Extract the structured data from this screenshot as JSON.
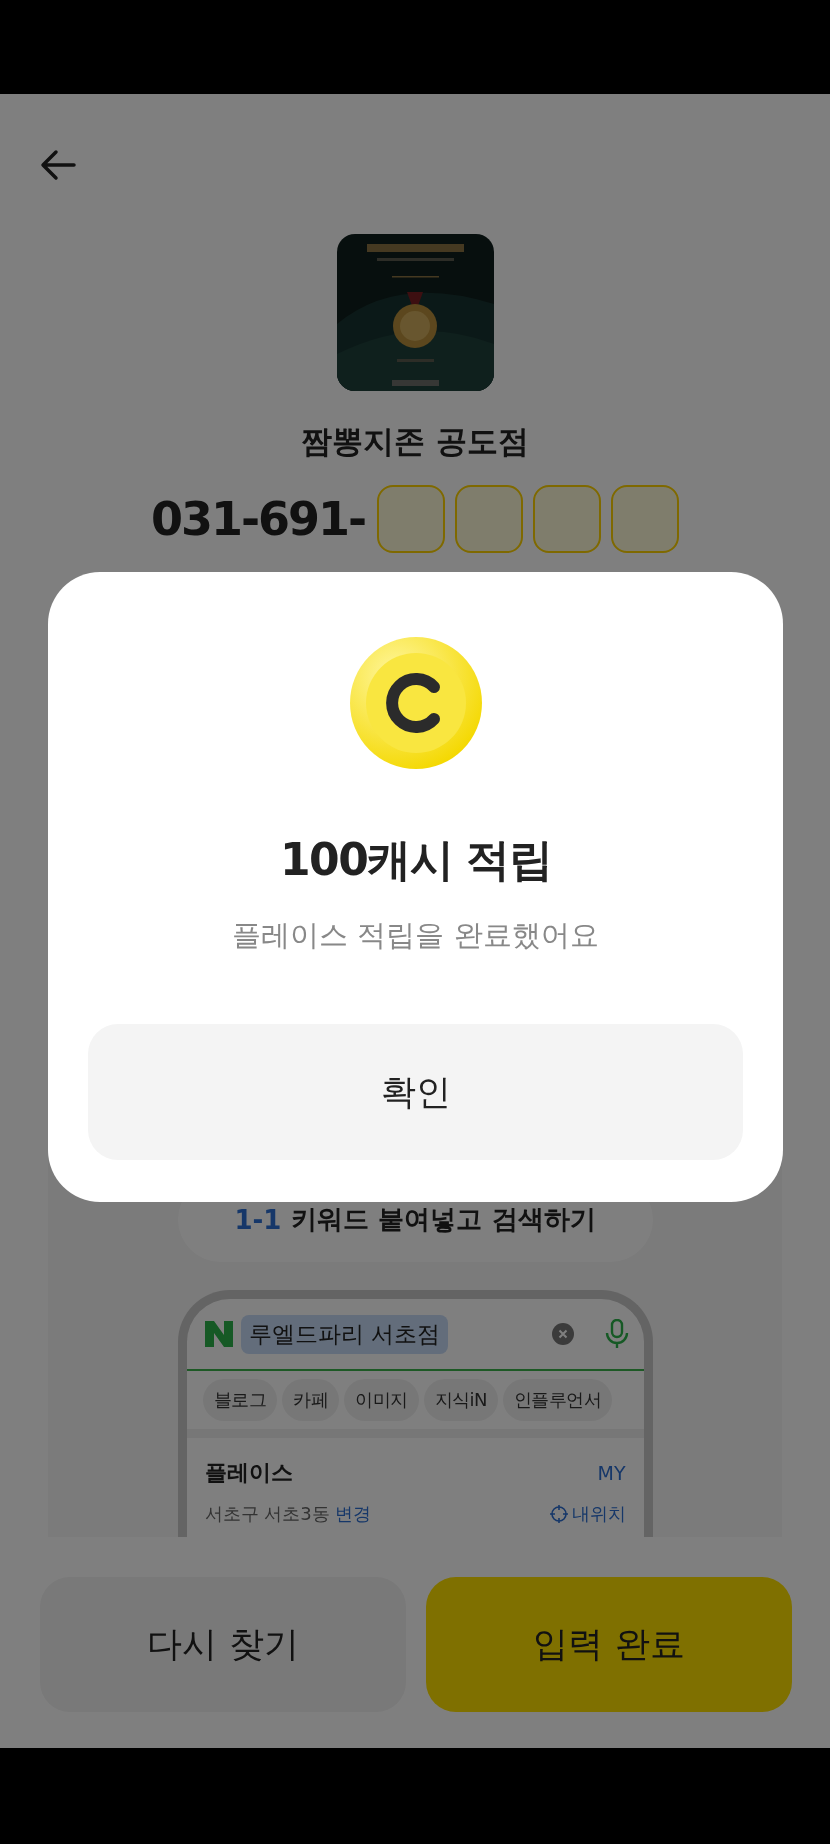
{
  "store": {
    "name": "짬뽕지존 공도점"
  },
  "phone": {
    "prefix": "031-691-",
    "digit_boxes": [
      {
        "filled": false
      },
      {
        "filled": false
      },
      {
        "filled": false
      },
      {
        "filled": false
      }
    ]
  },
  "guide": {
    "step_number": "1-1",
    "step_text": "키워드 붙여넣고 검색하기",
    "mockup": {
      "query": "루엘드파리 서초점",
      "chips": [
        "블로그",
        "카페",
        "이미지",
        "지식iN",
        "인플루언서"
      ],
      "section_title": "플레이스",
      "section_link": "MY",
      "location": "서초구 서초3동",
      "location_link": "변경",
      "my_location": "내위치"
    }
  },
  "buttons": [
    {
      "label": "다시 찾기",
      "kind": "secondary"
    },
    {
      "label": "입력 완료",
      "kind": "primary"
    }
  ],
  "dialog": {
    "title": "100캐시 적립",
    "message": "플레이스 적립을 완료했어요",
    "confirm": "확인"
  }
}
